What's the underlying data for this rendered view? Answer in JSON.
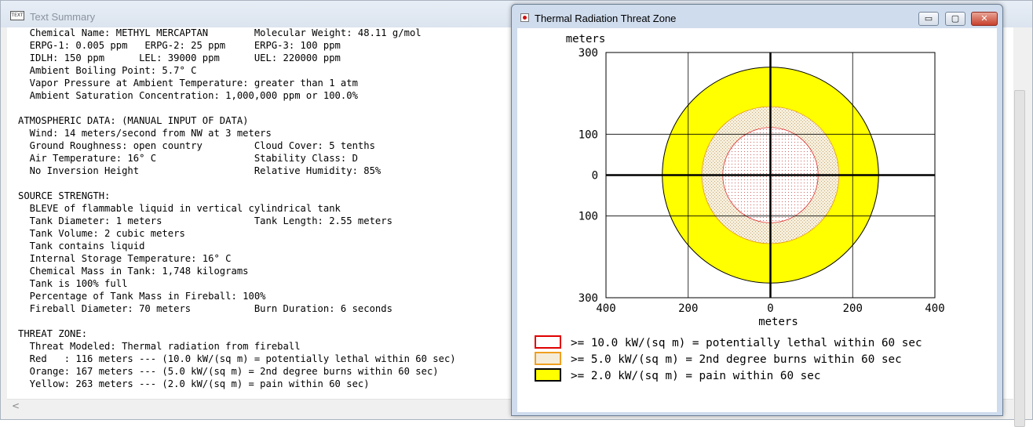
{
  "text_summary": {
    "title": "Text Summary",
    "lines": [
      "  Chemical Name: METHYL MERCAPTAN        Molecular Weight: 48.11 g/mol",
      "  ERPG-1: 0.005 ppm   ERPG-2: 25 ppm     ERPG-3: 100 ppm",
      "  IDLH: 150 ppm      LEL: 39000 ppm      UEL: 220000 ppm",
      "  Ambient Boiling Point: 5.7° C",
      "  Vapor Pressure at Ambient Temperature: greater than 1 atm",
      "  Ambient Saturation Concentration: 1,000,000 ppm or 100.0%",
      "",
      "ATMOSPHERIC DATA: (MANUAL INPUT OF DATA)",
      "  Wind: 14 meters/second from NW at 3 meters",
      "  Ground Roughness: open country         Cloud Cover: 5 tenths",
      "  Air Temperature: 16° C                 Stability Class: D",
      "  No Inversion Height                    Relative Humidity: 85%",
      "",
      "SOURCE STRENGTH:",
      "  BLEVE of flammable liquid in vertical cylindrical tank",
      "  Tank Diameter: 1 meters                Tank Length: 2.55 meters",
      "  Tank Volume: 2 cubic meters",
      "  Tank contains liquid",
      "  Internal Storage Temperature: 16° C",
      "  Chemical Mass in Tank: 1,748 kilograms",
      "  Tank is 100% full",
      "  Percentage of Tank Mass in Fireball: 100%",
      "  Fireball Diameter: 70 meters           Burn Duration: 6 seconds",
      "",
      "THREAT ZONE:",
      "  Threat Modeled: Thermal radiation from fireball",
      "  Red   : 116 meters --- (10.0 kW/(sq m) = potentially lethal within 60 sec)",
      "  Orange: 167 meters --- (5.0 kW/(sq m) = 2nd degree burns within 60 sec)",
      "  Yellow: 263 meters --- (2.0 kW/(sq m) = pain within 60 sec)"
    ]
  },
  "threat_window": {
    "title": "Thermal Radiation Threat Zone",
    "buttons": {
      "minimize": "▭",
      "maximize": "▢",
      "close": "✕"
    }
  },
  "chart_data": {
    "type": "threat-zone-circles",
    "y_unit_label": "meters",
    "x_unit_label": "meters",
    "xlim": [
      -400,
      400
    ],
    "ylim": [
      -300,
      300
    ],
    "x_tick_labels": [
      {
        "value": -400,
        "label": "400"
      },
      {
        "value": -200,
        "label": "200"
      },
      {
        "value": 0,
        "label": "0"
      },
      {
        "value": 200,
        "label": "200"
      },
      {
        "value": 400,
        "label": "400"
      }
    ],
    "y_tick_labels": [
      {
        "value": 300,
        "label": "300"
      },
      {
        "value": 100,
        "label": "100"
      },
      {
        "value": 0,
        "label": "0"
      },
      {
        "value": -100,
        "label": "100"
      },
      {
        "value": -300,
        "label": "300"
      }
    ],
    "grid": true,
    "zones": [
      {
        "name": "Yellow",
        "radius_m": 263,
        "fill": "#ffff00",
        "border": "#000000",
        "pattern": "solid"
      },
      {
        "name": "Orange",
        "radius_m": 167,
        "fill": "#f4ecd8",
        "border": "#e69a10",
        "pattern": "dots"
      },
      {
        "name": "Red",
        "radius_m": 116,
        "fill": "#ffffff",
        "border": "#e03030",
        "pattern": "dots"
      }
    ],
    "legend": [
      {
        "text": ">= 10.0 kW/(sq m) = potentially lethal within 60 sec",
        "swatch_border": "#e00000",
        "swatch_fill": "#ffffff"
      },
      {
        "text": ">= 5.0 kW/(sq m) = 2nd degree burns within 60 sec",
        "swatch_border": "#f0a020",
        "swatch_fill": "#f4ecd8"
      },
      {
        "text": ">= 2.0 kW/(sq m) = pain within 60 sec",
        "swatch_border": "#000000",
        "swatch_fill": "#ffff00"
      }
    ]
  }
}
